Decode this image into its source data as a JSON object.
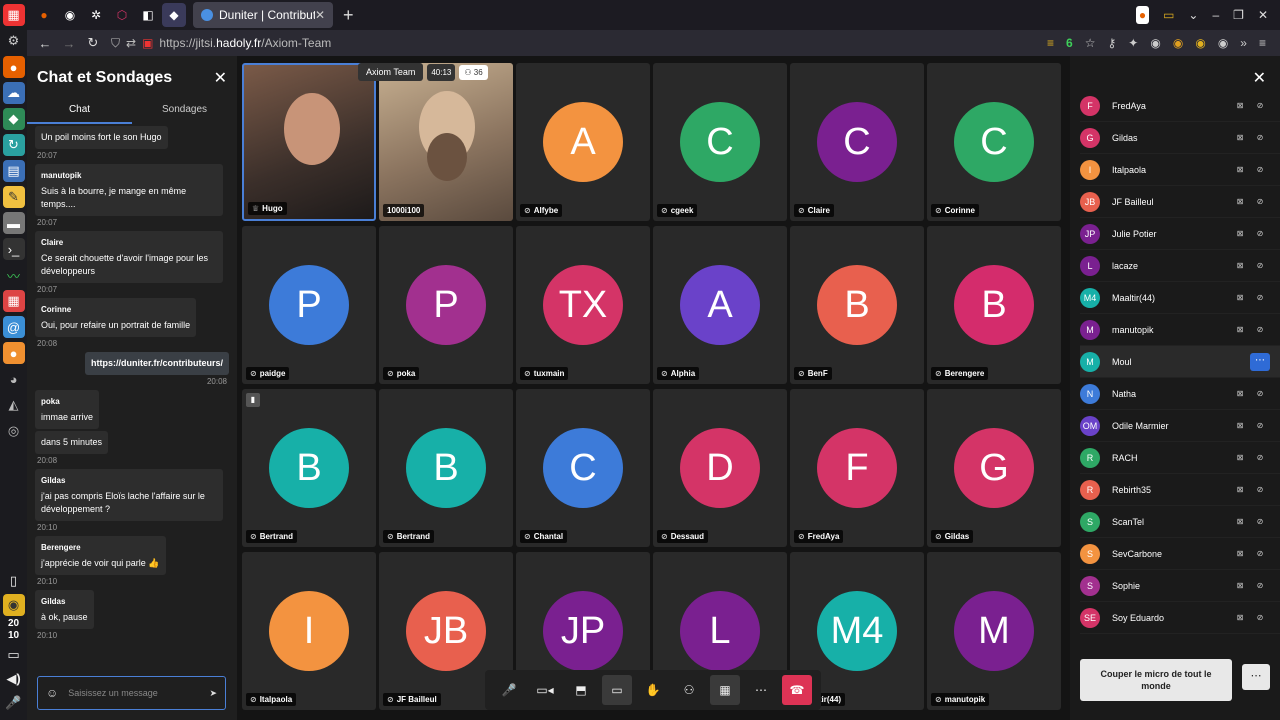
{
  "browser": {
    "tab_title": "Duniter | Contributeurs",
    "url_prefix": "https://jitsi.",
    "url_host": "hadoly.fr",
    "url_path": "/Axiom-Team",
    "tracker_count": "6"
  },
  "clock": {
    "hour": "20",
    "minute": "10"
  },
  "chat": {
    "title": "Chat et Sondages",
    "tab_chat": "Chat",
    "tab_polls": "Sondages",
    "input_placeholder": "Saisissez un message",
    "messages": [
      {
        "author": "",
        "text": "Un poil moins fort le son Hugo",
        "time": "20:07",
        "mine": false
      },
      {
        "author": "manutopik",
        "text": "Suis à la bourre, je mange en même temps....",
        "time": "20:07",
        "mine": false
      },
      {
        "author": "Claire",
        "text": "Ce serait chouette d'avoir l'image pour les développeurs",
        "time": "20:07",
        "mine": false
      },
      {
        "author": "Corinne",
        "text": "Oui, pour refaire un portrait de famille",
        "time": "20:08",
        "mine": false
      },
      {
        "author": "",
        "text": "https://duniter.fr/contributeurs/",
        "time": "20:08",
        "mine": true
      },
      {
        "author": "poka",
        "text": "immae arrive",
        "time": "",
        "mine": false
      },
      {
        "author": "",
        "text": "dans 5 minutes",
        "time": "20:08",
        "mine": false
      },
      {
        "author": "Gildas",
        "text": "j'ai pas compris Eloïs lache l'affaire sur le développement ?",
        "time": "20:10",
        "mine": false
      },
      {
        "author": "Berengere",
        "text": "j'apprécie de voir qui parle 👍",
        "time": "20:10",
        "mine": false
      },
      {
        "author": "Gildas",
        "text": "à ok, pause",
        "time": "20:10",
        "mine": false
      }
    ]
  },
  "conference": {
    "name": "Axiom Team",
    "duration": "40:13",
    "participant_count": "36"
  },
  "tiles": [
    {
      "name": "Hugo",
      "initials": "",
      "color": "",
      "video": "video1"
    },
    {
      "name": "1000i100",
      "initials": "",
      "color": "",
      "video": "video2"
    },
    {
      "name": "Alfybe",
      "initials": "A",
      "color": "#f39340"
    },
    {
      "name": "cgeek",
      "initials": "C",
      "color": "#2ea865"
    },
    {
      "name": "Claire",
      "initials": "C",
      "color": "#7a2090"
    },
    {
      "name": "Corinne",
      "initials": "C",
      "color": "#2ea865"
    },
    {
      "name": "paidge",
      "initials": "P",
      "color": "#3d7bd9"
    },
    {
      "name": "poka",
      "initials": "P",
      "color": "#a2308f"
    },
    {
      "name": "tuxmain",
      "initials": "TX",
      "color": "#d43467"
    },
    {
      "name": "Alphia",
      "initials": "A",
      "color": "#6a42c9"
    },
    {
      "name": "BenF",
      "initials": "B",
      "color": "#e8604e"
    },
    {
      "name": "Berengere",
      "initials": "B",
      "color": "#d42c6c"
    },
    {
      "name": "Bertrand",
      "initials": "B",
      "color": "#17b0a8"
    },
    {
      "name": "Bertrand",
      "initials": "B",
      "color": "#17b0a8"
    },
    {
      "name": "Chantal",
      "initials": "C",
      "color": "#3d7bd9"
    },
    {
      "name": "Dessaud",
      "initials": "D",
      "color": "#d43467"
    },
    {
      "name": "FredAya",
      "initials": "F",
      "color": "#d43467"
    },
    {
      "name": "Gildas",
      "initials": "G",
      "color": "#d43467"
    },
    {
      "name": "Italpaola",
      "initials": "I",
      "color": "#f39340"
    },
    {
      "name": "JF Bailleul",
      "initials": "JB",
      "color": "#e8604e"
    },
    {
      "name": "",
      "initials": "JP",
      "color": "#7a2090"
    },
    {
      "name": "",
      "initials": "L",
      "color": "#7a2090"
    },
    {
      "name": "aaltir(44)",
      "initials": "M4",
      "color": "#17b0a8"
    },
    {
      "name": "manutopik",
      "initials": "M",
      "color": "#7a2090"
    }
  ],
  "participants": [
    {
      "name": "FredAya",
      "initials": "F",
      "color": "#d43467"
    },
    {
      "name": "Gildas",
      "initials": "G",
      "color": "#d43467"
    },
    {
      "name": "Italpaola",
      "initials": "I",
      "color": "#f39340"
    },
    {
      "name": "JF Bailleul",
      "initials": "JB",
      "color": "#e8604e"
    },
    {
      "name": "Julie Potier",
      "initials": "JP",
      "color": "#7a2090"
    },
    {
      "name": "lacaze",
      "initials": "L",
      "color": "#7a2090"
    },
    {
      "name": "Maaltir(44)",
      "initials": "M4",
      "color": "#17b0a8"
    },
    {
      "name": "manutopik",
      "initials": "M",
      "color": "#7a2090"
    },
    {
      "name": "Moul",
      "initials": "M",
      "color": "#17b0a8",
      "highlight": true
    },
    {
      "name": "Natha",
      "initials": "N",
      "color": "#3d7bd9"
    },
    {
      "name": "Odile Marmier",
      "initials": "OM",
      "color": "#6a42c9"
    },
    {
      "name": "RACH",
      "initials": "R",
      "color": "#2ea865"
    },
    {
      "name": "Rebirth35",
      "initials": "R",
      "color": "#e8604e"
    },
    {
      "name": "ScanTel",
      "initials": "S",
      "color": "#2ea865"
    },
    {
      "name": "SevCarbone",
      "initials": "S",
      "color": "#f39340"
    },
    {
      "name": "Sophie",
      "initials": "S",
      "color": "#a2308f"
    },
    {
      "name": "Soy Eduardo",
      "initials": "SE",
      "color": "#d43467"
    }
  ],
  "mute_all_label": "Couper le micro de tout le monde"
}
